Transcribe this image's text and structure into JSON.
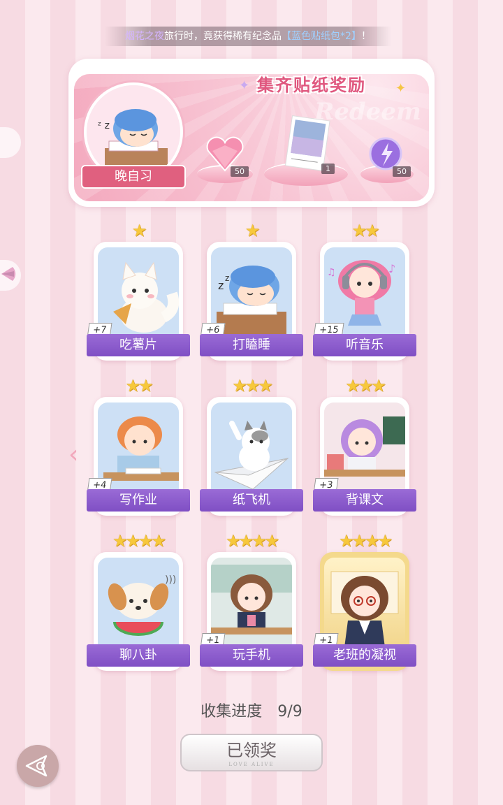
{
  "ticker": {
    "name": "烟花之夜",
    "middle": "旅行时，竟获得稀有纪念品",
    "item": "【蓝色贴纸包*2】",
    "end": "！"
  },
  "banner": {
    "title": "集齐贴纸奖励",
    "watermark": "Redeem",
    "portrait_label": "晚自习",
    "rewards": [
      {
        "icon": "pink-heart-gem-icon",
        "count": "50"
      },
      {
        "icon": "photo-card-icon",
        "count": "1"
      },
      {
        "icon": "purple-orb-icon",
        "count": "50"
      }
    ]
  },
  "cards": [
    {
      "label": "吃薯片",
      "count": "+7",
      "stars": "★",
      "art": "white-fox-eating-chips"
    },
    {
      "label": "打瞌睡",
      "count": "+6",
      "stars": "★",
      "art": "blue-hair-boy-sleeping"
    },
    {
      "label": "听音乐",
      "count": "+15",
      "stars": "★★",
      "art": "pink-hair-girl-headphones"
    },
    {
      "label": "写作业",
      "count": "+4",
      "stars": "★★",
      "art": "orange-hair-boy-writing"
    },
    {
      "label": "纸飞机",
      "count": "",
      "stars": "★★★",
      "art": "cat-paper-plane"
    },
    {
      "label": "背课文",
      "count": "+3",
      "stars": "★★★",
      "art": "purple-hair-girl-desk"
    },
    {
      "label": "聊八卦",
      "count": "",
      "stars": "★★★★",
      "art": "puppy-watermelon"
    },
    {
      "label": "玩手机",
      "count": "+1",
      "stars": "★★★★",
      "art": "brown-hair-girl-phone"
    },
    {
      "label": "老班的凝视",
      "count": "+1",
      "stars": "★★★★",
      "art": "teacher-glasses"
    }
  ],
  "progress": {
    "label": "收集进度",
    "value": "9/9"
  },
  "claim_button": {
    "label": "已领奖",
    "sub": "LOVE ALIVE"
  },
  "colors": {
    "accent": "#e0587f",
    "card_label": "#8a5bcc",
    "star": "#f7c83c"
  }
}
